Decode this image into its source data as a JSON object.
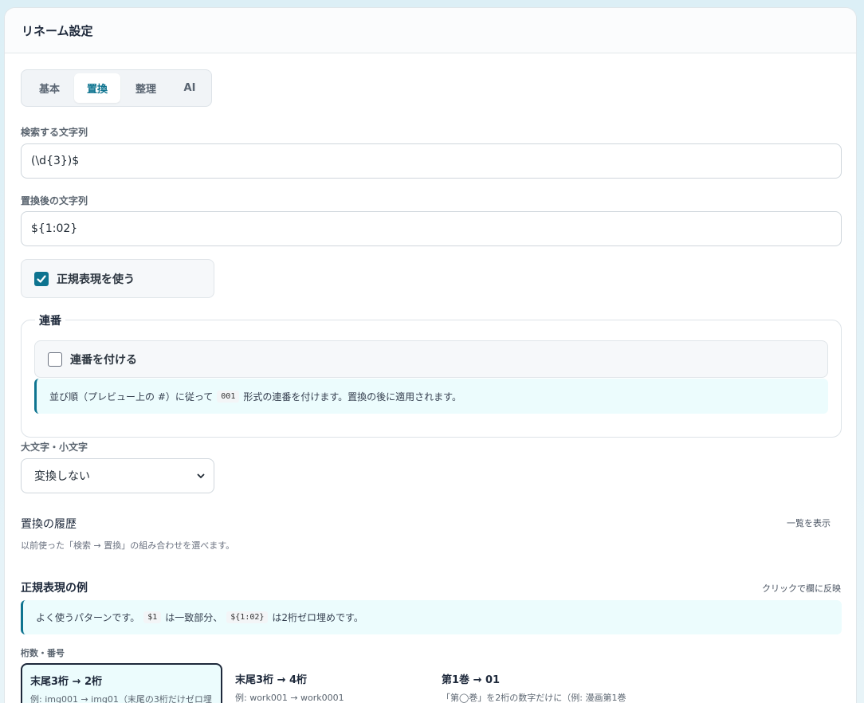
{
  "panel": {
    "title": "リネーム設定"
  },
  "tabs": [
    {
      "label": "基本",
      "active": false
    },
    {
      "label": "置換",
      "active": true
    },
    {
      "label": "整理",
      "active": false
    },
    {
      "label": "AI",
      "active": false
    }
  ],
  "search": {
    "label": "検索する文字列",
    "value": "(\\d{3})$"
  },
  "replace": {
    "label": "置換後の文字列",
    "value": "${1:02}"
  },
  "regex": {
    "label": "正規表現を使う",
    "checked": true
  },
  "sequence": {
    "legend": "連番",
    "checkbox_label": "連番を付ける",
    "checked": false,
    "info_before": "並び順（プレビュー上の #）に従って",
    "info_code": "001",
    "info_after": "形式の連番を付けます。置換の後に適用されます。"
  },
  "case": {
    "label": "大文字・小文字",
    "selected": "変換しない"
  },
  "history": {
    "title": "置換の履歴",
    "show_list": "一覧を表示",
    "description": "以前使った「検索 → 置換」の組み合わせを選べます。"
  },
  "examples": {
    "title": "正規表現の例",
    "hint": "クリックで欄に反映",
    "info_before": "よく使うパターンです。",
    "info_code1": "$1",
    "info_middle": "は一致部分、",
    "info_code2": "${1:02}",
    "info_after": "は2桁ゼロ埋めです。",
    "group_label": "桁数・番号",
    "cards": [
      {
        "title": "末尾3桁 → 2桁",
        "desc": "例: img001 → img01（末尾の3桁だけゼロ埋",
        "selected": true
      },
      {
        "title": "末尾3桁 → 4桁",
        "desc": "例: work001 → work0001",
        "selected": false
      },
      {
        "title": "第1巻 → 01",
        "desc": "「第◯巻」を2桁の数字だけに（例: 漫画第1巻",
        "selected": false
      }
    ]
  },
  "colors": {
    "accent": "#0e7490",
    "info_bg": "#ecfcfd",
    "selected_border": "#1e293b"
  }
}
